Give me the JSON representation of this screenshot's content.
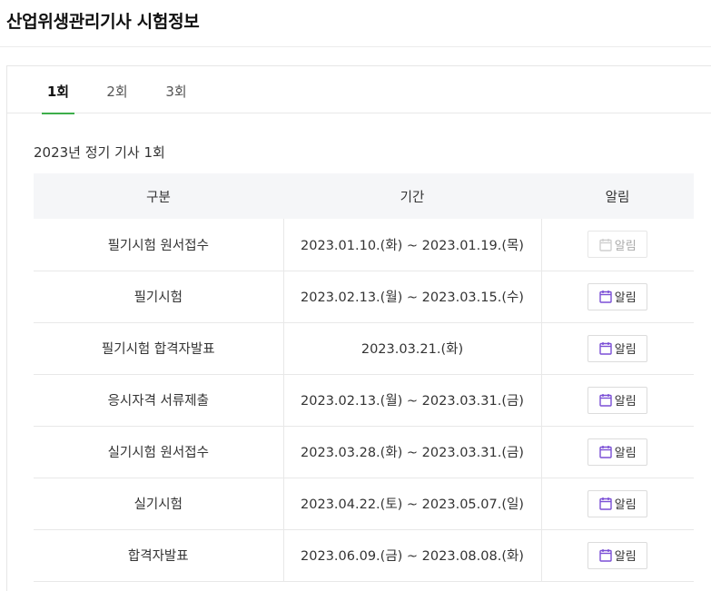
{
  "page": {
    "title": "산업위생관리기사 시험정보"
  },
  "tabs": [
    {
      "label": "1회",
      "active": true
    },
    {
      "label": "2회",
      "active": false
    },
    {
      "label": "3회",
      "active": false
    }
  ],
  "section": {
    "title": "2023년 정기 기사 1회"
  },
  "table": {
    "headers": [
      "구분",
      "기간",
      "알림"
    ],
    "rows": [
      {
        "division": "필기시험 원서접수",
        "period": "2023.01.10.(화) ~ 2023.01.19.(목)",
        "alert_label": "알림",
        "alert_enabled": false
      },
      {
        "division": "필기시험",
        "period": "2023.02.13.(월) ~ 2023.03.15.(수)",
        "alert_label": "알림",
        "alert_enabled": true
      },
      {
        "division": "필기시험 합격자발표",
        "period": "2023.03.21.(화)",
        "alert_label": "알림",
        "alert_enabled": true
      },
      {
        "division": "응시자격 서류제출",
        "period": "2023.02.13.(월) ~ 2023.03.31.(금)",
        "alert_label": "알림",
        "alert_enabled": true
      },
      {
        "division": "실기시험 원서접수",
        "period": "2023.03.28.(화) ~ 2023.03.31.(금)",
        "alert_label": "알림",
        "alert_enabled": true
      },
      {
        "division": "실기시험",
        "period": "2023.04.22.(토) ~ 2023.05.07.(일)",
        "alert_label": "알림",
        "alert_enabled": true
      },
      {
        "division": "합격자발표",
        "period": "2023.06.09.(금) ~ 2023.08.08.(화)",
        "alert_label": "알림",
        "alert_enabled": true
      }
    ]
  },
  "colors": {
    "tab_active_underline": "#3dae4a",
    "calendar_icon_active": "#7b4fd6",
    "calendar_icon_disabled": "#cfcfcf",
    "header_bg": "#f5f6f8"
  },
  "icons": {
    "alert": "calendar-icon"
  }
}
